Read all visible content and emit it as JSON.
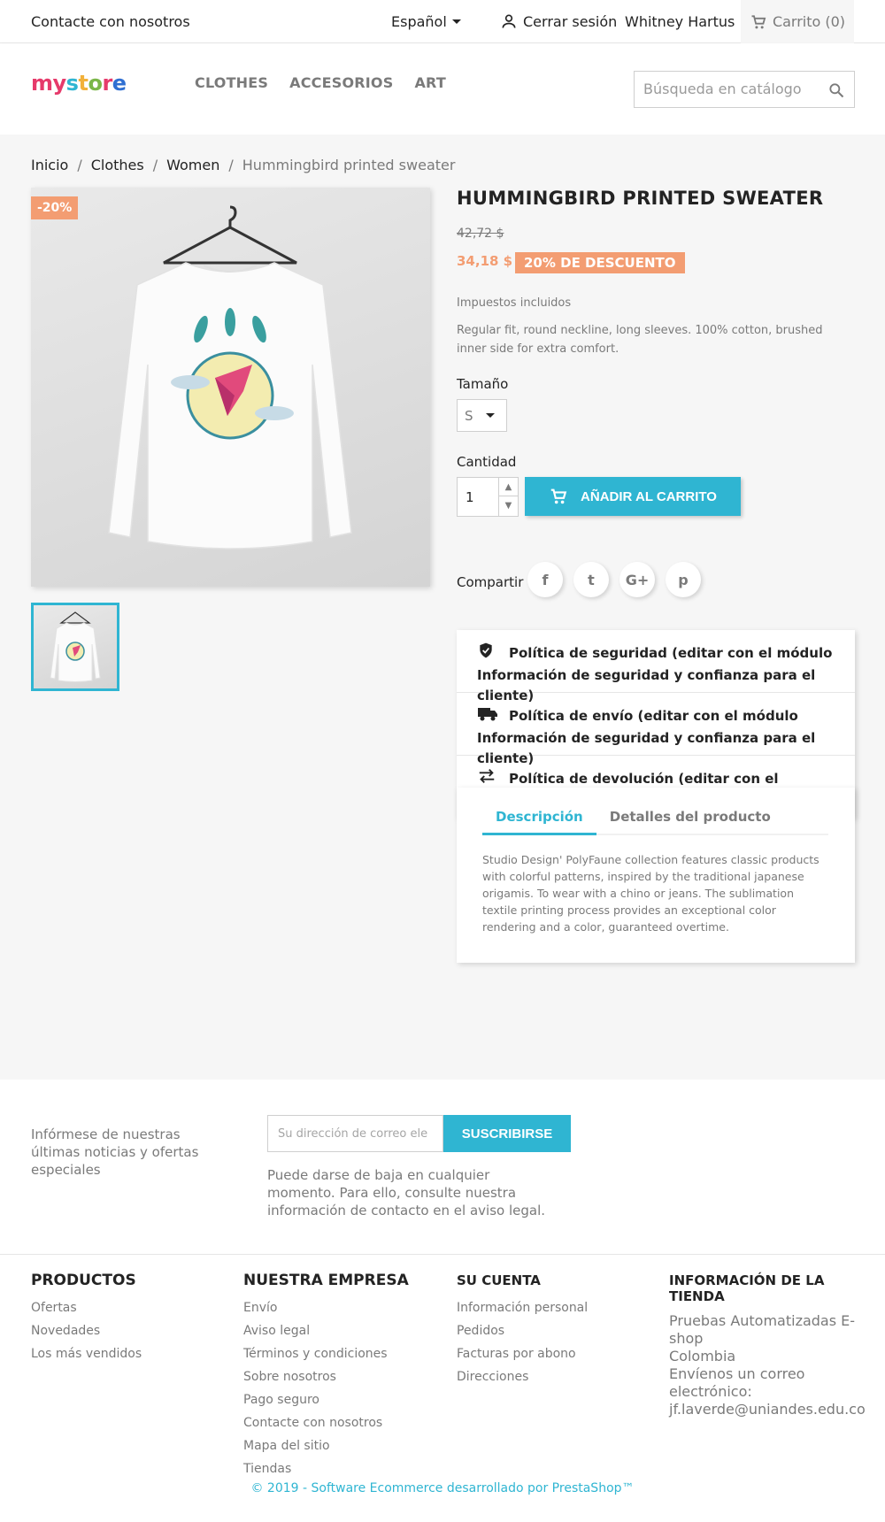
{
  "topbar": {
    "contact": "Contacte con nosotros",
    "language": "Español",
    "logout": "Cerrar sesión",
    "username": "Whitney Hartus",
    "cart": "Carrito (0)"
  },
  "header": {
    "logo_parts": [
      "my",
      " ",
      "s",
      "t",
      "o",
      "r",
      "e"
    ],
    "nav": [
      "CLOTHES",
      "ACCESORIOS",
      "ART"
    ],
    "search_placeholder": "Búsqueda en catálogo"
  },
  "breadcrumb": [
    "Inicio",
    "Clothes",
    "Women",
    "Hummingbird printed sweater"
  ],
  "product": {
    "discount_flag": "-20%",
    "title": "HUMMINGBIRD PRINTED SWEATER",
    "old_price": "42,72 $",
    "new_price": "34,18 $",
    "discount_badge": "20% DE DESCUENTO",
    "tax_label": "Impuestos incluidos",
    "short_description": "Regular fit, round neckline, long sleeves. 100% cotton, brushed inner side for extra comfort.",
    "size_label": "Tamaño",
    "size_value": "S",
    "quantity_label": "Cantidad",
    "quantity_value": "1",
    "add_to_cart": "AÑADIR AL CARRITO",
    "share_label": "Compartir",
    "share_icons": [
      "f",
      "t",
      "G+",
      "p"
    ]
  },
  "reassurance": [
    {
      "icon": "shield-icon",
      "text": "Política de seguridad (editar con el módulo Información de seguridad y confianza para el cliente)"
    },
    {
      "icon": "truck-icon",
      "text": "Política de envío (editar con el módulo Información de seguridad y confianza para el cliente)"
    },
    {
      "icon": "swap-arrows-icon",
      "text": "Política de devolución (editar con el módulo Información de seguridad y confianza para el cliente)"
    }
  ],
  "tabs": {
    "items": [
      "Descripción",
      "Detalles del producto"
    ],
    "active": 0,
    "description": "Studio Design' PolyFaune collection features classic products with colorful patterns, inspired by the traditional japanese origamis. To wear with a chino or jeans. The sublimation textile printing process provides an exceptional color rendering and a color, guaranteed overtime."
  },
  "newsletter": {
    "text": "Infórmese de nuestras últimas noticias y ofertas especiales",
    "placeholder": "Su dirección de correo electrónico",
    "button": "SUSCRIBIRSE",
    "note": "Puede darse de baja en cualquier momento. Para ello, consulte nuestra información de contacto en el aviso legal."
  },
  "footer": {
    "columns": [
      {
        "title": "PRODUCTOS",
        "links": [
          "Ofertas",
          "Novedades",
          "Los más vendidos"
        ]
      },
      {
        "title": "NUESTRA EMPRESA",
        "links": [
          "Envío",
          "Aviso legal",
          "Términos y condiciones",
          "Sobre nosotros",
          "Pago seguro",
          "Contacte con nosotros",
          "Mapa del sitio",
          "Tiendas"
        ]
      },
      {
        "title": "SU CUENTA",
        "links": [
          "Información personal",
          "Pedidos",
          "Facturas por abono",
          "Direcciones"
        ]
      }
    ],
    "store_info": {
      "title": "INFORMACIÓN DE LA TIENDA",
      "name": "Pruebas Automatizadas E-shop",
      "country": "Colombia",
      "email_label": "Envíenos un correo electrónico:",
      "email": "jf.laverde@uniandes.edu.co"
    },
    "copyright": "© 2019 - Software Ecommerce desarrollado por PrestaShop™"
  },
  "colors": {
    "accent": "#2fb5d2",
    "discount": "#f39d72",
    "text": "#232323",
    "muted": "#7a7a7a"
  }
}
